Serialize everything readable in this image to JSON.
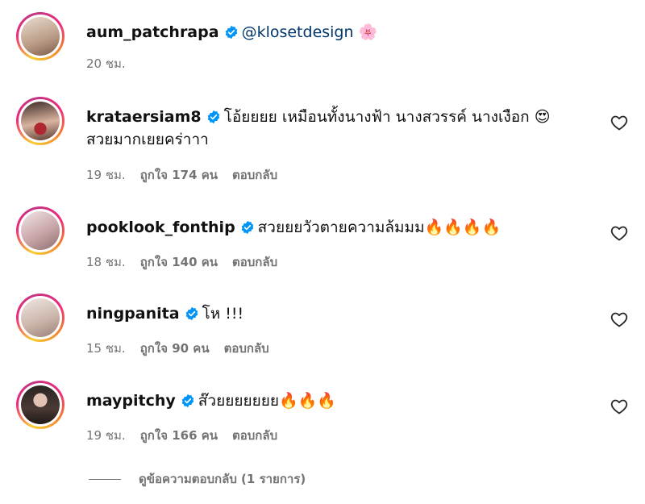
{
  "caption": {
    "username": "aum_patchrapa",
    "mention": "@klosetdesign",
    "emoji": "🌸",
    "time": "20 ชม."
  },
  "comments": [
    {
      "username": "krataersiam8",
      "text_line1": "โอ้ยยยย เหมือนทั้งนางฟ้า นางสวรรค์ นางเงือก 😍",
      "text_line2": "สวยมากเยยคร่าาา",
      "time": "19 ชม.",
      "likes": "ถูกใจ 174 คน",
      "reply": "ตอบกลับ"
    },
    {
      "username": "pooklook_fonthip",
      "text_line1": "สวยยยวัวตายความล้มมม🔥🔥🔥🔥",
      "time": "18 ชม.",
      "likes": "ถูกใจ 140 คน",
      "reply": "ตอบกลับ"
    },
    {
      "username": "ningpanita",
      "text_line1": "โห !!!",
      "time": "15 ชม.",
      "likes": "ถูกใจ 90 คน",
      "reply": "ตอบกลับ"
    },
    {
      "username": "maypitchy",
      "text_line1": "ส๊วยยยยยยย🔥🔥🔥",
      "time": "19 ชม.",
      "likes": "ถูกใจ 166 คน",
      "reply": "ตอบกลับ"
    }
  ],
  "view_replies": "ดูข้อความตอบกลับ (1 รายการ)",
  "colors": {
    "verified": "#0095f6",
    "meta": "#737373",
    "mention": "#00376b"
  },
  "icons": [
    "verified-badge-icon",
    "heart-icon"
  ]
}
